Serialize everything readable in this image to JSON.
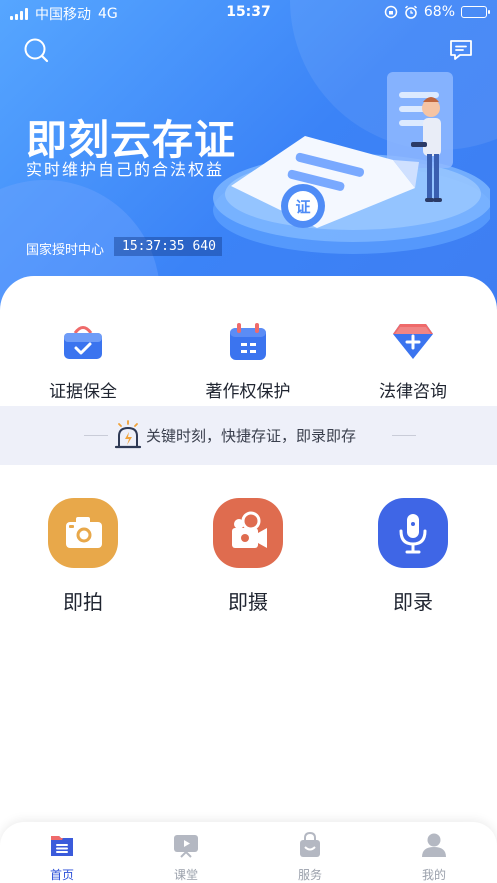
{
  "status_bar": {
    "carrier": "中国移动",
    "network": "4G",
    "time": "15:37",
    "battery": "68%",
    "battery_level": 0.68
  },
  "hero": {
    "title": "即刻云存证",
    "subtitle": "实时维护自己的合法权益",
    "time_label": "国家授时中心",
    "time_value": "15:37:35  640",
    "illustration_badge": "证"
  },
  "services": [
    {
      "label": "证据保全",
      "icon": "basket-check-icon"
    },
    {
      "label": "著作权保护",
      "icon": "calendar-icon"
    },
    {
      "label": "法律咨询",
      "icon": "diamond-plus-icon"
    }
  ],
  "slogan": "关键时刻，快捷存证，即录即存",
  "actions": [
    {
      "label": "即拍",
      "icon": "camera-icon",
      "color": "#e8a84a"
    },
    {
      "label": "即摄",
      "icon": "video-camera-icon",
      "color": "#df6c4f"
    },
    {
      "label": "即录",
      "icon": "microphone-icon",
      "color": "#3f66e6"
    }
  ],
  "tabs": [
    {
      "label": "首页",
      "icon": "home-icon",
      "active": true
    },
    {
      "label": "课堂",
      "icon": "classroom-icon",
      "active": false
    },
    {
      "label": "服务",
      "icon": "shopping-bag-icon",
      "active": false
    },
    {
      "label": "我的",
      "icon": "user-icon",
      "active": false
    }
  ],
  "colors": {
    "hero_gradient_start": "#56a6ff",
    "hero_gradient_end": "#3f7ef2",
    "accent": "#2b4fd8",
    "slogan_bg": "#eef0f9"
  }
}
